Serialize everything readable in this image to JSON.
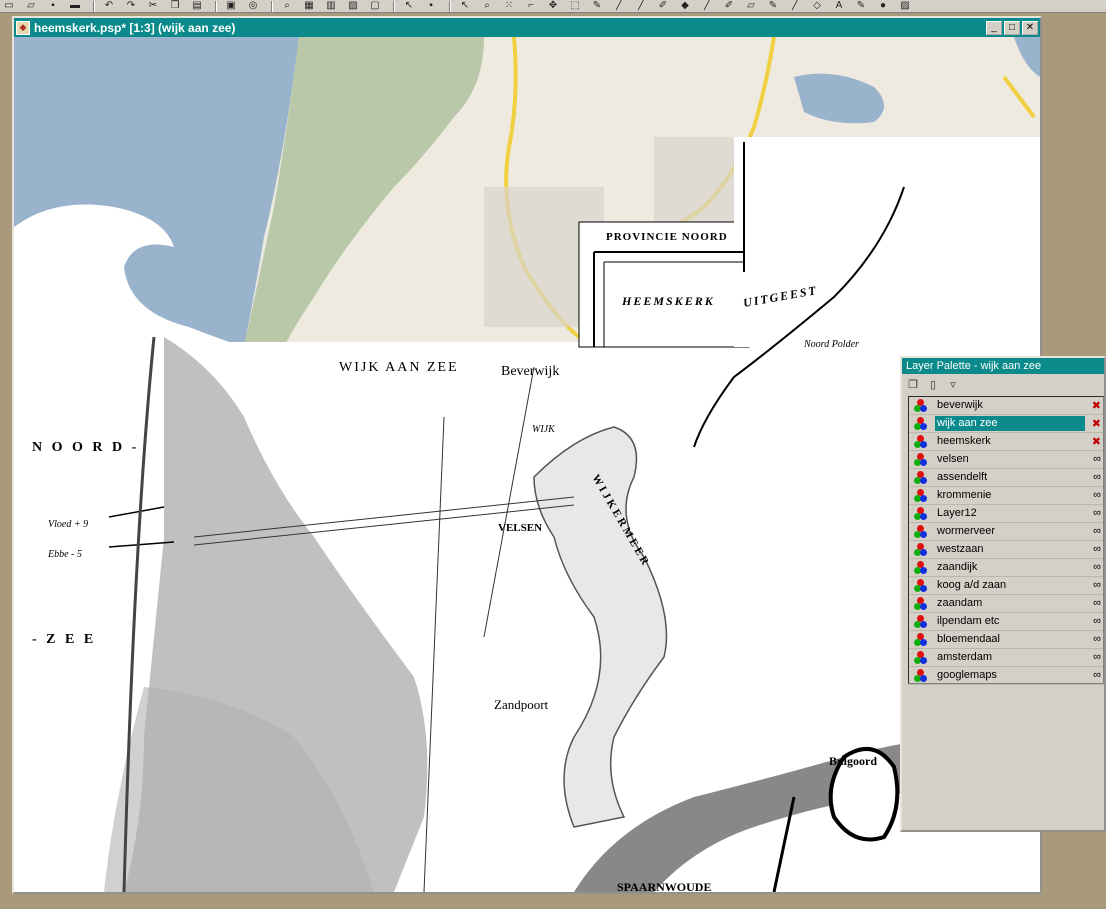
{
  "toolbar": {
    "icons": [
      "new-icon",
      "open-icon",
      "save-icon",
      "print-icon",
      "undo-icon",
      "redo-icon",
      "cut-icon",
      "copy-icon",
      "paste-icon",
      "browse-icon",
      "zoom-icon",
      "histogram-icon",
      "color-icon",
      "overview-icon",
      "pointer-icon",
      "lasso-icon",
      "zoom-tool-icon",
      "select-icon",
      "move-icon",
      "crop-icon",
      "dropper-icon",
      "brush-icon",
      "clone-icon",
      "retouch-icon",
      "eraser-icon",
      "fill-icon",
      "text-icon",
      "shape-icon",
      "airbrush-icon"
    ]
  },
  "document": {
    "title": "heemskerk.psp* [1:3] (wijk aan zee)",
    "minimize_label": "_",
    "maximize_label": "□",
    "close_label": "✕"
  },
  "map_labels": {
    "wijk_aan_zee": "WIJK AAN ZEE",
    "beverwijk": "Beverwijk",
    "noord": "N O O R D -",
    "zee": "- Z E E",
    "provincie": "PROVINCIE NOORD",
    "heemskerk": "HEEMSKERK",
    "uitgeest": "UITGEEST",
    "velsen": "VELSEN",
    "wijker_meer": "W I J K E R  M E E R",
    "zandpoort": "Zandpoort",
    "bulgoord": "Bulgoord",
    "spaarnwoude": "SPAARNWOUDE",
    "vloed": "Vloed + 9",
    "ebbe": "Ebbe - 5",
    "wijk": "WIJK",
    "noord_polder": "Noord Polder"
  },
  "layer_palette": {
    "title": "Layer Palette - wijk aan zee",
    "tools": [
      "new-layer-icon",
      "delete-layer-icon",
      "layer-properties-icon"
    ],
    "layers": [
      {
        "name": "beverwijk",
        "hidden": true,
        "selected": false
      },
      {
        "name": "wijk aan zee",
        "hidden": true,
        "selected": true
      },
      {
        "name": "heemskerk",
        "hidden": true,
        "selected": false
      },
      {
        "name": "velsen",
        "hidden": false,
        "selected": false
      },
      {
        "name": "assendelft",
        "hidden": false,
        "selected": false
      },
      {
        "name": "krommenie",
        "hidden": false,
        "selected": false
      },
      {
        "name": "Layer12",
        "hidden": false,
        "selected": false
      },
      {
        "name": "wormerveer",
        "hidden": false,
        "selected": false
      },
      {
        "name": "westzaan",
        "hidden": false,
        "selected": false
      },
      {
        "name": "zaandijk",
        "hidden": false,
        "selected": false
      },
      {
        "name": "koog a/d zaan",
        "hidden": false,
        "selected": false
      },
      {
        "name": "zaandam",
        "hidden": false,
        "selected": false
      },
      {
        "name": "ilpendam etc",
        "hidden": false,
        "selected": false
      },
      {
        "name": "bloemendaal",
        "hidden": false,
        "selected": false
      },
      {
        "name": "amsterdam",
        "hidden": false,
        "selected": false
      },
      {
        "name": "googlemaps",
        "hidden": false,
        "selected": false
      }
    ]
  },
  "colors": {
    "titlebar": "#0a8a8a",
    "sea": "#99b3cc",
    "land": "#eeeae0",
    "dunes": "#b8c8a8"
  }
}
